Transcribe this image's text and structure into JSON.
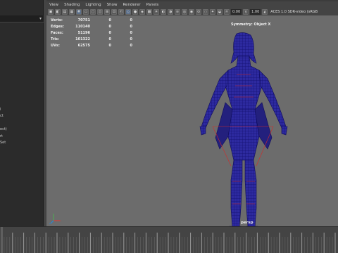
{
  "panel_menu": [
    "View",
    "Shading",
    "Lighting",
    "Show",
    "Renderer",
    "Panels"
  ],
  "toolbar": {
    "field_a": "0.00",
    "field_b": "1.00",
    "color_space": "ACES 1.0 SDR-video (sRGB"
  },
  "hud": {
    "rows": [
      {
        "label": "Verts:",
        "v1": "70751",
        "v2": "0",
        "v3": "0"
      },
      {
        "label": "Edges:",
        "v1": "110140",
        "v2": "0",
        "v3": "0"
      },
      {
        "label": "Faces:",
        "v1": "51196",
        "v2": "0",
        "v3": "0"
      },
      {
        "label": "Tris:",
        "v1": "101322",
        "v2": "0",
        "v3": "0"
      },
      {
        "label": "UVs:",
        "v1": "62575",
        "v2": "0",
        "v3": "0"
      }
    ],
    "symmetry": "Symmetry: Object X",
    "camera": "persp"
  },
  "outliner_fragments": [
    "l",
    "ct",
    "ect)",
    "rt",
    "Set"
  ],
  "colors": {
    "viewport_bg": "#6c6c6c",
    "wire": "#1d1aa8",
    "selection_edge": "#d42a2a",
    "panel_bg": "#444444"
  }
}
